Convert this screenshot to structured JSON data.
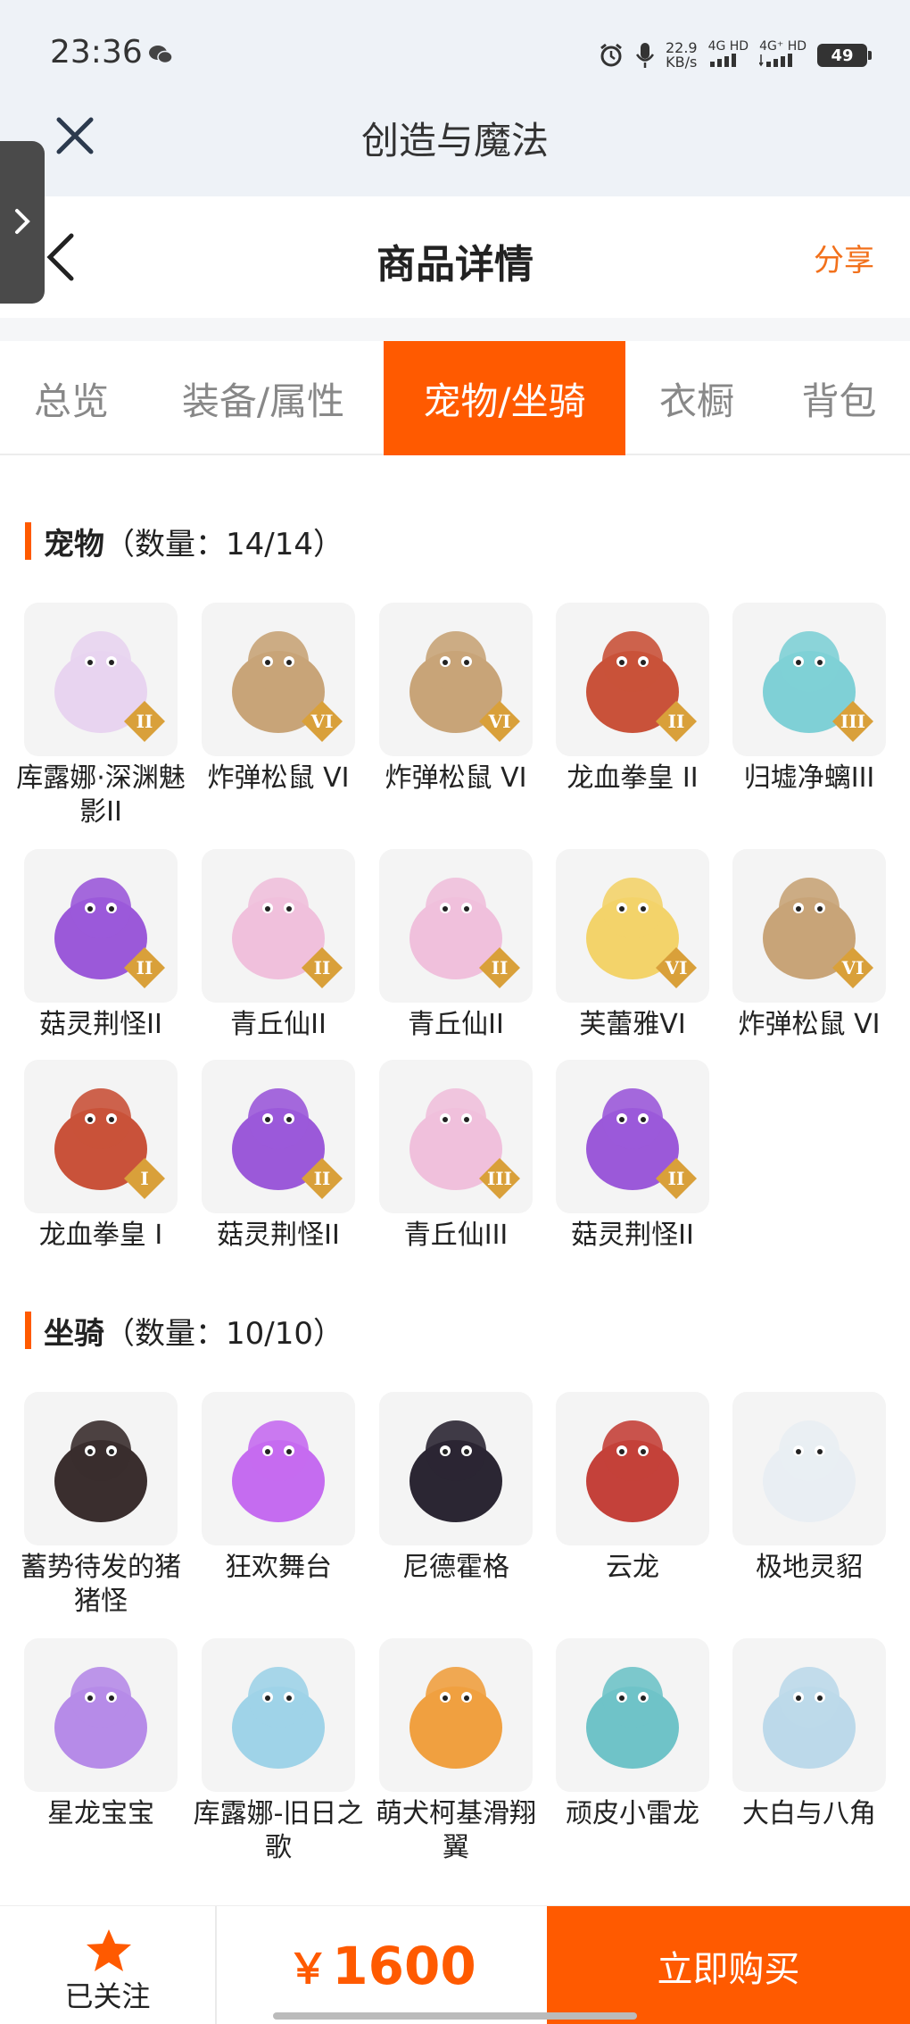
{
  "status_bar": {
    "time": "23:36",
    "speed_value": "22.9",
    "speed_unit": "KB/s",
    "net1": "4G HD",
    "net2": "4G⁺ HD",
    "battery": "49"
  },
  "app": {
    "title": "创造与魔法"
  },
  "header": {
    "title": "商品详情",
    "share_label": "分享"
  },
  "tabs": [
    {
      "label": "总览",
      "active": false
    },
    {
      "label": "装备/属性",
      "active": false
    },
    {
      "label": "宠物/坐骑",
      "active": true
    },
    {
      "label": "衣橱",
      "active": false
    },
    {
      "label": "背包",
      "active": false
    }
  ],
  "pets": {
    "title": "宠物",
    "count": "（数量：14/14）",
    "items": [
      {
        "name": "库露娜·深渊魅影II",
        "icon": "goddess-icon",
        "color": "#e8d4f0",
        "grade": "II"
      },
      {
        "name": "炸弹松鼠 VI",
        "icon": "squirrel-icon",
        "color": "#c8a478",
        "grade": "VI"
      },
      {
        "name": "炸弹松鼠 VI",
        "icon": "squirrel-icon",
        "color": "#c8a478",
        "grade": "VI"
      },
      {
        "name": "龙血拳皇 II",
        "icon": "beast-icon",
        "color": "#c9523a",
        "grade": "II"
      },
      {
        "name": "归墟净螭III",
        "icon": "sea-dragon-icon",
        "color": "#7fd0d6",
        "grade": "III"
      },
      {
        "name": "菇灵荆怪II",
        "icon": "mushroom-imp-icon",
        "color": "#9b59d9",
        "grade": "II"
      },
      {
        "name": "青丘仙II",
        "icon": "fox-fairy-icon",
        "color": "#f0c0dc",
        "grade": "II"
      },
      {
        "name": "青丘仙II",
        "icon": "fox-fairy-icon",
        "color": "#f0c0dc",
        "grade": "II"
      },
      {
        "name": "芙蕾雅VI",
        "icon": "valkyrie-icon",
        "color": "#f3d36a",
        "grade": "VI"
      },
      {
        "name": "炸弹松鼠 VI",
        "icon": "squirrel-icon",
        "color": "#c8a478",
        "grade": "VI"
      },
      {
        "name": "龙血拳皇 I",
        "icon": "beast-icon",
        "color": "#c9523a",
        "grade": "I"
      },
      {
        "name": "菇灵荆怪II",
        "icon": "mushroom-imp-icon",
        "color": "#9b59d9",
        "grade": "II"
      },
      {
        "name": "青丘仙III",
        "icon": "fox-fairy-icon",
        "color": "#f0c0dc",
        "grade": "III"
      },
      {
        "name": "菇灵荆怪II",
        "icon": "mushroom-imp-icon",
        "color": "#9b59d9",
        "grade": "II"
      }
    ]
  },
  "mounts": {
    "title": "坐骑",
    "count": "（数量：10/10）",
    "items": [
      {
        "name": "蓄势待发的猪猪怪",
        "icon": "pig-icon",
        "color": "#3a2e2e"
      },
      {
        "name": "狂欢舞台",
        "icon": "stage-icon",
        "color": "#c56cf0"
      },
      {
        "name": "尼德霍格",
        "icon": "black-dragon-icon",
        "color": "#2b2633"
      },
      {
        "name": "云龙",
        "icon": "cloud-dragon-icon",
        "color": "#c4413a"
      },
      {
        "name": "极地灵貂",
        "icon": "snow-ferret-icon",
        "color": "#e9eef3"
      },
      {
        "name": "星龙宝宝",
        "icon": "baby-dragon-icon",
        "color": "#b68be8"
      },
      {
        "name": "库露娜-旧日之歌",
        "icon": "cloud-girl-icon",
        "color": "#9fd3e8"
      },
      {
        "name": "萌犬柯基滑翔翼",
        "icon": "corgi-glider-icon",
        "color": "#f0a040"
      },
      {
        "name": "顽皮小雷龙",
        "icon": "dino-icon",
        "color": "#6fc3c8"
      },
      {
        "name": "大白与八角",
        "icon": "whale-icon",
        "color": "#bcd9ea"
      }
    ]
  },
  "footer": {
    "follow_label": "已关注",
    "price_symbol": "￥",
    "price": "1600",
    "buy_label": "立即购买"
  },
  "colors": {
    "accent": "#ff5a00",
    "share": "#f2711c",
    "grade_badge": "#d9a03a"
  }
}
